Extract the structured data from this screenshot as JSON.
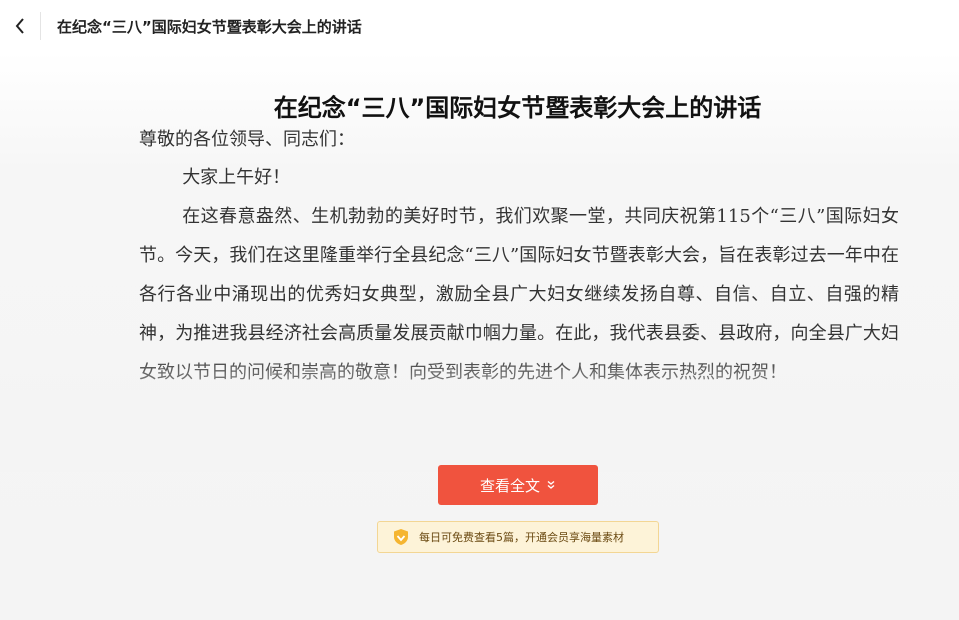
{
  "header": {
    "back_icon": "chevron-left-icon",
    "title": "在纪念“三八”国际妇女节暨表彰大会上的讲话"
  },
  "document": {
    "title": "在纪念“三八”国际妇女节暨表彰大会上的讲话",
    "salutation": "尊敬的各位领导、同志们：",
    "greeting": "大家上午好！",
    "paragraph1": "在这春意盎然、生机勃勃的美好时节，我们欢聚一堂，共同庆祝第115个“三八”国际妇女节。今天，我们在这里隆重举行全县纪念“三八”国际妇女节暨表彰大会，旨在表彰过去一年中在各行各业中涌现出的优秀妇女典型，激励全县广大妇女继续发扬自尊、自信、自立、自强的精神，为推进我县经济社会高质量发展贡献巾帼力量。在此，我代表县委、县政府，向全县广大妇女致以节日的问候和崇高的敬意！向受到表彰的先进个人和集体表示热烈的祝贺！"
  },
  "actions": {
    "read_full_label": "查看全文",
    "read_full_icon": "double-chevron-down-icon"
  },
  "notice": {
    "icon": "vip-shield-icon",
    "text": "每日可免费查看5篇，开通会员享海量素材"
  },
  "colors": {
    "accent": "#f0533e",
    "notice_bg": "#fdf3d8",
    "notice_border": "#f3d694"
  }
}
